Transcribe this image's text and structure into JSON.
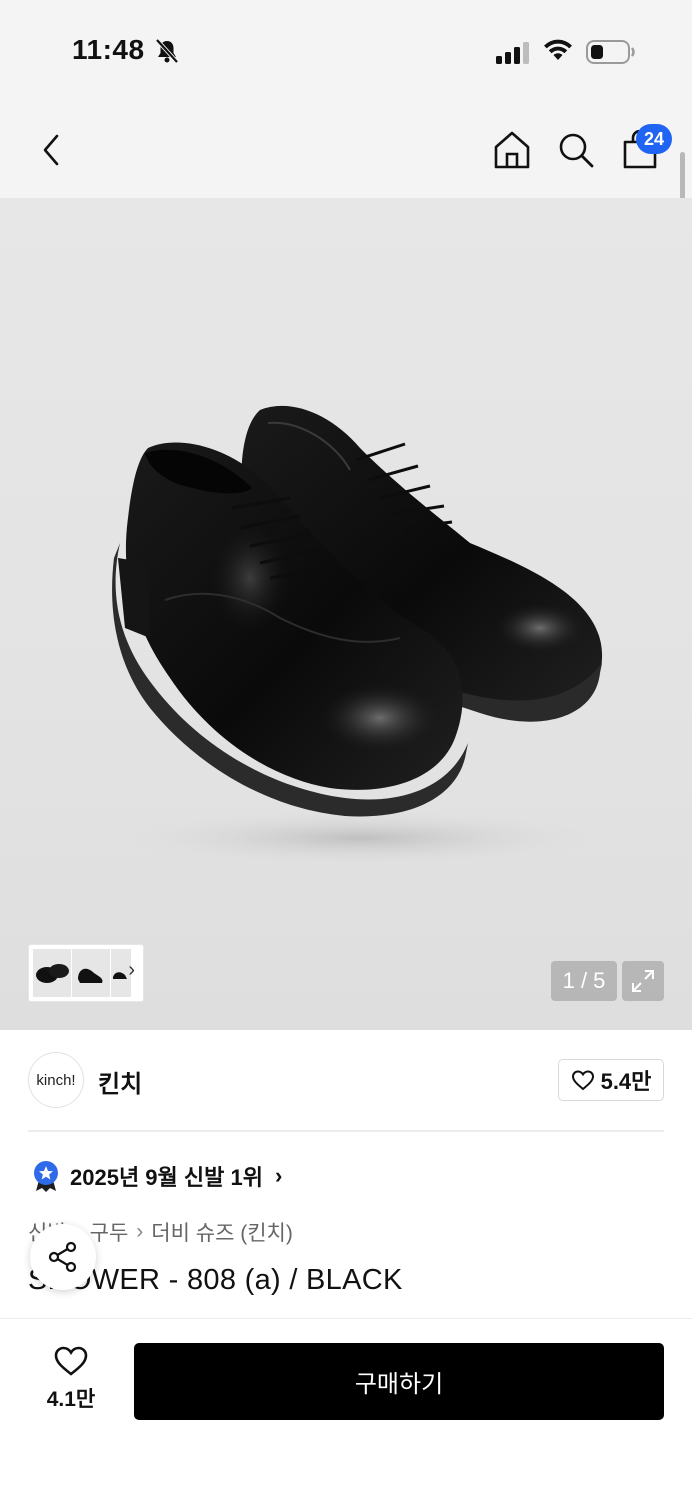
{
  "status_bar": {
    "time": "11:48",
    "icons": [
      "bell-off-icon",
      "signal-icon",
      "wifi-icon",
      "battery-icon"
    ]
  },
  "header": {
    "icons": [
      "chevron-left-icon",
      "home-icon",
      "search-icon",
      "shopping-bag-icon"
    ],
    "cart_count": "24"
  },
  "gallery": {
    "page_counter": "1 / 5",
    "thumbnail_arrow": "›",
    "fullscreen_icon": "expand-icon"
  },
  "brand": {
    "logo_text": "kinch!",
    "name": "킨치",
    "like_count": "5.4만"
  },
  "ranking": {
    "text": "2025년 9월 신발 1위",
    "arrow": "›",
    "badge_color": "#2f6be8"
  },
  "breadcrumb": {
    "items": [
      "신발",
      "구두",
      "더비 슈즈 (킨치)"
    ],
    "separator": "›"
  },
  "product": {
    "title": "SHOWER - 808 (a) / BLACK"
  },
  "bottom_bar": {
    "wish_count": "4.1만",
    "buy_label": "구매하기"
  },
  "colors": {
    "accent": "#1f64f2",
    "buy_button": "#000000"
  }
}
